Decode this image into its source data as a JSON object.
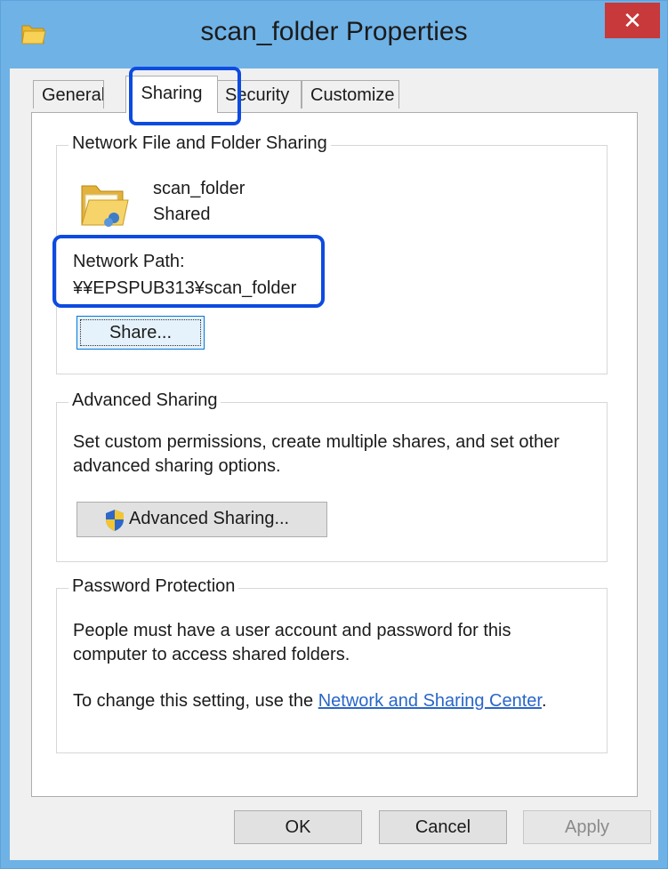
{
  "window": {
    "title": "scan_folder Properties",
    "close_label": "✕"
  },
  "tabs": [
    {
      "label": "General"
    },
    {
      "label": "Sharing",
      "active": true
    },
    {
      "label": "Security"
    },
    {
      "label": "Customize"
    }
  ],
  "network_sharing": {
    "group_label": "Network File and Folder Sharing",
    "folder_name": "scan_folder",
    "folder_status": "Shared",
    "network_path_label": "Network Path:",
    "network_path_value": "¥¥EPSPUB313¥scan_folder",
    "share_button": "Share..."
  },
  "advanced_sharing": {
    "group_label": "Advanced Sharing",
    "description_line1": "Set custom permissions, create multiple shares, and set other",
    "description_line2": "advanced sharing options.",
    "button": "Advanced Sharing..."
  },
  "password_protection": {
    "group_label": "Password Protection",
    "description_line1": "People must have a user account and password for this",
    "description_line2": "computer to access shared folders.",
    "change_prefix": "To change this setting, use the ",
    "link_text": "Network and Sharing Center",
    "change_suffix": "."
  },
  "footer": {
    "ok": "OK",
    "cancel": "Cancel",
    "apply": "Apply"
  },
  "colors": {
    "accent_frame": "#6fb2e6",
    "close": "#c7393a",
    "highlight": "#0d4be0",
    "link": "#2966c9"
  }
}
